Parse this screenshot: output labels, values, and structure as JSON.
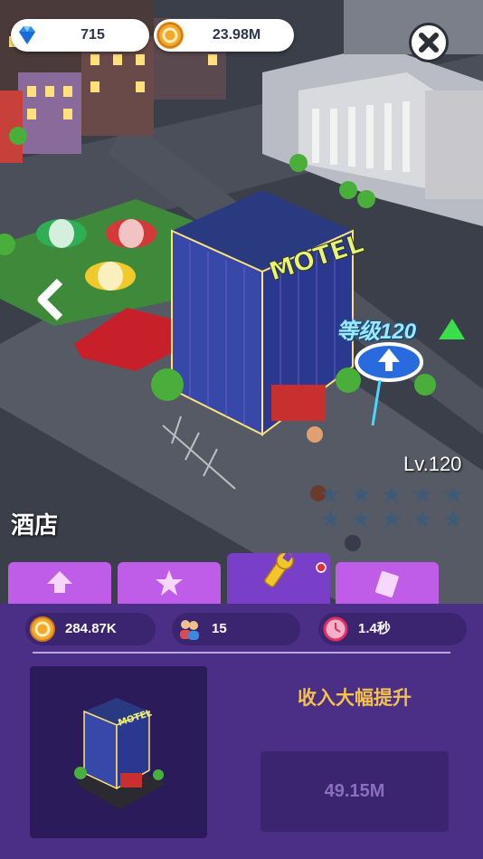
{
  "currency": {
    "gems": "715",
    "coins": "23.98M"
  },
  "building": {
    "sign_level": "等级120",
    "level": "Lv.120",
    "name": "酒店",
    "stars_total": 10,
    "stars_filled": 0,
    "sign_text": "MOTEL"
  },
  "tabs": [
    {
      "icon": "arrow-up-icon"
    },
    {
      "icon": "star-icon"
    },
    {
      "icon": "wrench-icon",
      "active": true,
      "badge": true
    },
    {
      "icon": "card-icon"
    }
  ],
  "stats": {
    "income": "284.87K",
    "staff": "15",
    "time": "1.4秒"
  },
  "upgrade": {
    "title": "收入大幅提升",
    "cost": "49.15M"
  },
  "colors": {
    "tab": "#bf5ce8",
    "tab_active": "#7a3fc8",
    "panel": "#4b2f86",
    "gold_text": "#f3c24a"
  }
}
